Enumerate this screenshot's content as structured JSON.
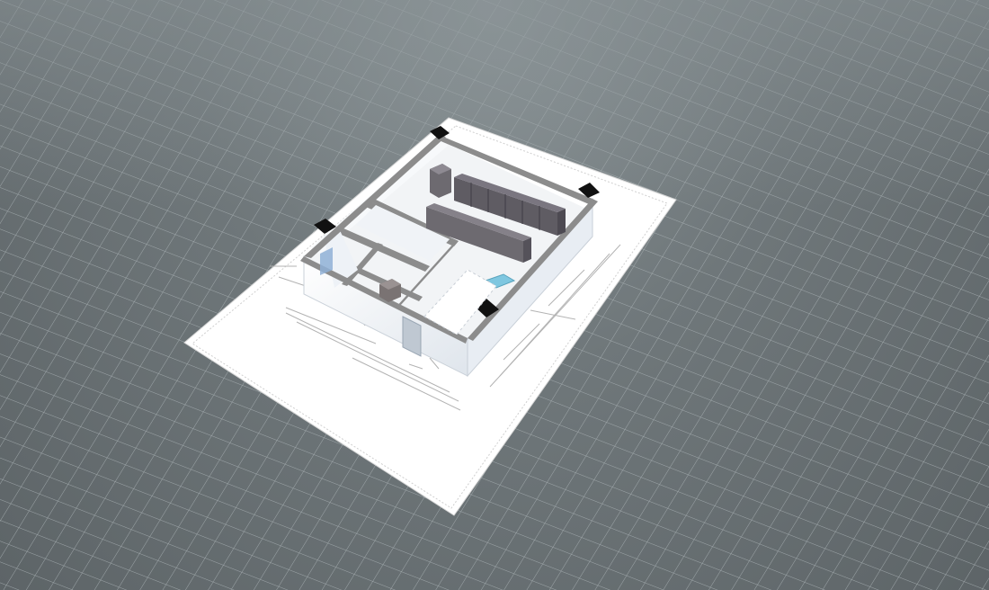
{
  "viewer": {
    "background_color": "#6f777a",
    "grid_color": "#9aa3a6",
    "sheet_color": "#ffffff",
    "wall_top_color": "#8c8c8c",
    "wall_face_color": "#eef1f5",
    "rack_color": "#6d6a70",
    "pillar_color": "#111111"
  },
  "scene": {
    "equipment": {
      "rack_rows": 2,
      "racks_per_row": 6
    }
  }
}
